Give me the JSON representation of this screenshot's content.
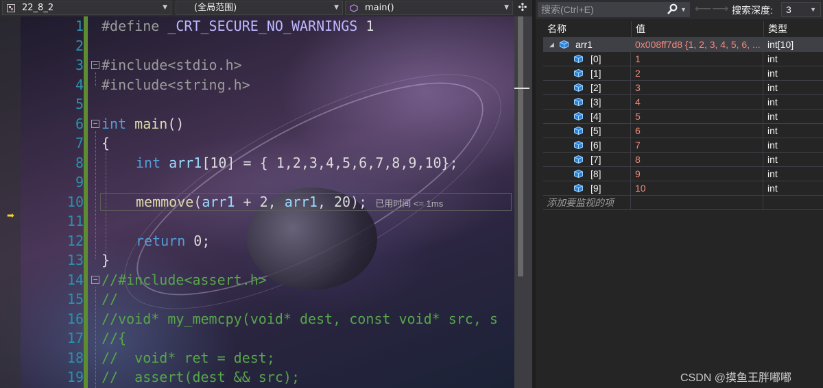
{
  "editor": {
    "nav": {
      "project": "22_8_2",
      "scope": "(全局范围)",
      "function": "main()"
    },
    "code_lines": [
      {
        "n": "1"
      },
      {
        "n": "2"
      },
      {
        "n": "3"
      },
      {
        "n": "4"
      },
      {
        "n": "5"
      },
      {
        "n": "6"
      },
      {
        "n": "7"
      },
      {
        "n": "8"
      },
      {
        "n": "9"
      },
      {
        "n": "10"
      },
      {
        "n": "11"
      },
      {
        "n": "12"
      },
      {
        "n": "13"
      },
      {
        "n": "14"
      },
      {
        "n": "15"
      },
      {
        "n": "16"
      },
      {
        "n": "17"
      },
      {
        "n": "18"
      },
      {
        "n": "19"
      }
    ],
    "tokens": {
      "l1a": "#define ",
      "l1b": "_CRT_SECURE_NO_WARNINGS",
      "l1c": " 1",
      "l3": "#include<stdio.h>",
      "l4": "#include<string.h>",
      "l6a": "int",
      "l6b": " main",
      "l6c": "()",
      "l7": "{",
      "l8a": "int",
      "l8b": " arr1",
      "l8c": "[10] = { 1,2,3,4,5,6,7,8,9,10};",
      "l10a": "memmove",
      "l10b": "(",
      "l10c": "arr1",
      "l10d": " + 2, ",
      "l10e": "arr1",
      "l10f": ", 20);",
      "l10perf": "已用时间 <= 1ms",
      "l12a": "return",
      "l12b": " 0;",
      "l13": "}",
      "l14": "//#include<assert.h>",
      "l15": "//",
      "l16": "//void* my_memcpy(void* dest, const void* src, s",
      "l17": "//{",
      "l18": "//  void* ret = dest;",
      "l19": "//  assert(dest && src);"
    }
  },
  "watch": {
    "search_placeholder": "搜索(Ctrl+E)",
    "depth_label": "搜索深度:",
    "depth_value": "3",
    "headers": {
      "name": "名称",
      "value": "值",
      "type": "类型"
    },
    "root": {
      "name": "arr1",
      "value": "0x008ff7d8 {1, 2, 3, 4, 5, 6, ...",
      "type": "int[10]"
    },
    "items": [
      {
        "name": "[0]",
        "value": "1",
        "type": "int"
      },
      {
        "name": "[1]",
        "value": "2",
        "type": "int"
      },
      {
        "name": "[2]",
        "value": "3",
        "type": "int"
      },
      {
        "name": "[3]",
        "value": "4",
        "type": "int"
      },
      {
        "name": "[4]",
        "value": "5",
        "type": "int"
      },
      {
        "name": "[5]",
        "value": "6",
        "type": "int"
      },
      {
        "name": "[6]",
        "value": "7",
        "type": "int"
      },
      {
        "name": "[7]",
        "value": "8",
        "type": "int"
      },
      {
        "name": "[8]",
        "value": "9",
        "type": "int"
      },
      {
        "name": "[9]",
        "value": "10",
        "type": "int"
      }
    ],
    "add_item": "添加要监视的项"
  },
  "watermark": "CSDN @摸鱼王胖嘟嘟",
  "colors": {
    "keyword": "#569cd6",
    "line_number": "#2b91af",
    "comment": "#57a64a",
    "value": "#f28b7a",
    "changed_bar": "#5e8c31"
  },
  "icons": [
    "project-icon",
    "namespace-icon",
    "function-icon",
    "split-icon",
    "search-icon",
    "back-arrow-icon",
    "forward-arrow-icon",
    "variable-cube-icon",
    "execution-arrow-icon"
  ]
}
